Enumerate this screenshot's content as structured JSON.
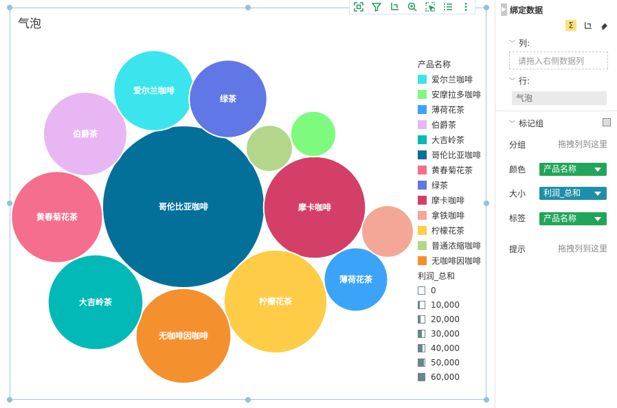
{
  "chart": {
    "title": "气泡",
    "toolbar": [
      "fullscreen-icon",
      "filter-icon",
      "axis-swap-icon",
      "zoom-icon",
      "select-icon",
      "list-icon",
      "more-icon"
    ]
  },
  "chart_data": {
    "type": "bubble",
    "title": "气泡",
    "color_legend_title": "产品名称",
    "size_legend_title": "利润_总和",
    "size_legend_values": [
      "0",
      "10,000",
      "20,000",
      "30,000",
      "40,000",
      "50,000",
      "60,000"
    ],
    "bubbles": [
      {
        "label": "哥伦比亚咖啡",
        "value": 58000,
        "color": "#03709a"
      },
      {
        "label": "摩卡咖啡",
        "value": 23000,
        "color": "#d33f66"
      },
      {
        "label": "柠檬花茶",
        "value": 23500,
        "color": "#ffcc47"
      },
      {
        "label": "黄春菊花茶",
        "value": 18500,
        "color": "#f66e8d"
      },
      {
        "label": "无咖啡因咖啡",
        "value": 20000,
        "color": "#f5902e"
      },
      {
        "label": "大吉岭茶",
        "value": 20000,
        "color": "#02b9b7"
      },
      {
        "label": "伯爵茶",
        "value": 15500,
        "color": "#e9b6f4"
      },
      {
        "label": "爱尔兰咖啡",
        "value": 14300,
        "color": "#3ae5ed"
      },
      {
        "label": "绿茶",
        "value": 13400,
        "color": "#6177e6"
      },
      {
        "label": "薄荷花茶",
        "value": 9000,
        "color": "#3ca4f8"
      },
      {
        "label": "拿铁咖啡",
        "value": 6000,
        "color": "#f4a796"
      },
      {
        "label": "安摩拉多咖啡",
        "value": 4600,
        "color": "#7efb7f"
      },
      {
        "label": "普通浓缩咖啡",
        "value": 4800,
        "color": "#b3d68a"
      }
    ],
    "legend": [
      {
        "label": "爱尔兰咖啡",
        "color": "#3ae5ed"
      },
      {
        "label": "安摩拉多咖啡",
        "color": "#7efb7f"
      },
      {
        "label": "薄荷花茶",
        "color": "#3ca4f8"
      },
      {
        "label": "伯爵茶",
        "color": "#e9b6f4"
      },
      {
        "label": "大吉岭茶",
        "color": "#02b9b7"
      },
      {
        "label": "哥伦比亚咖啡",
        "color": "#03709a"
      },
      {
        "label": "黄春菊花茶",
        "color": "#f66e8d"
      },
      {
        "label": "绿茶",
        "color": "#6177e6"
      },
      {
        "label": "摩卡咖啡",
        "color": "#d33f66"
      },
      {
        "label": "拿铁咖啡",
        "color": "#f4a796"
      },
      {
        "label": "柠檬花茶",
        "color": "#ffcc47"
      },
      {
        "label": "普通浓缩咖啡",
        "color": "#b3d68a"
      },
      {
        "label": "无咖啡因咖啡",
        "color": "#f5902e"
      }
    ]
  },
  "panel": {
    "title": "绑定数据",
    "columns_label": "列:",
    "columns_placeholder": "请拖入右侧数据列",
    "rows_label": "行:",
    "rows_value": "气泡",
    "marks_label": "标记组",
    "group_label": "分组",
    "group_hint": "拖拽列到这里",
    "color_label": "颜色",
    "color_value": "产品名称",
    "size_label": "大小",
    "size_value": "利润_总和",
    "tag_label": "标签",
    "tag_value": "产品名称",
    "tooltip_label": "提示",
    "tooltip_hint": "拖拽列到这里",
    "color_select_bg": "#22a55a",
    "size_select_bg": "#1f8fa8"
  }
}
